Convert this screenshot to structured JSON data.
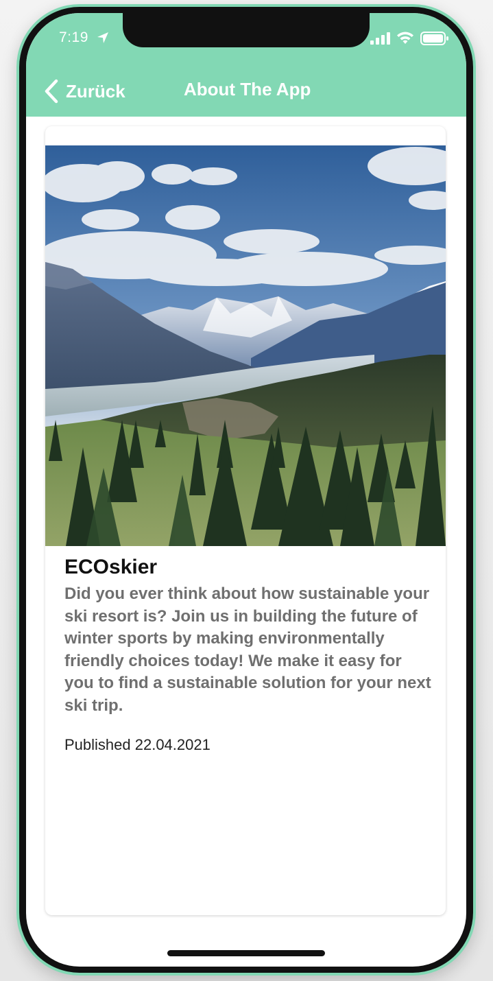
{
  "status_bar": {
    "time": "7:19",
    "icons": [
      "location-arrow-icon",
      "cellular-signal-icon",
      "wifi-icon",
      "battery-icon"
    ]
  },
  "nav": {
    "back_label": "Zurück",
    "title": "About The App"
  },
  "card": {
    "image_icon": "mountain-landscape-image",
    "app_name": "ECOskier",
    "description": "Did you ever think about how sustainable your ski resort is? Join us in building the future of winter sports by making environmentally friendly choices today! We make it easy for you to find a sustainable solution for your next ski trip.",
    "published": "Published 22.04.2021"
  },
  "colors": {
    "accent": "#82d8b4",
    "header_text": "#ffffff",
    "description_text": "#6f6f6f",
    "title_text": "#111111"
  }
}
